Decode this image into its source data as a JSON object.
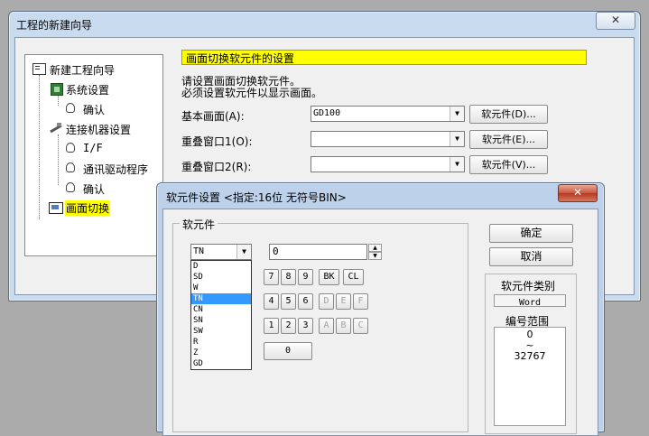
{
  "wizard": {
    "title": "工程的新建向导",
    "close_label": "✕",
    "tree": [
      {
        "label": "新建工程向导"
      },
      {
        "label": "系统设置"
      },
      {
        "label": "确认"
      },
      {
        "label": "连接机器设置"
      },
      {
        "label": "I/F"
      },
      {
        "label": "通讯驱动程序"
      },
      {
        "label": "确认"
      },
      {
        "label": "画面切换"
      }
    ],
    "header": "画面切换软元件的设置",
    "desc_line1": "请设置画面切换软元件。",
    "desc_line2": "必须设置软元件以显示画面。",
    "rows": [
      {
        "label": "基本画面(A):",
        "value": "GD100",
        "button": "软元件(D)..."
      },
      {
        "label": "重叠窗口1(O):",
        "value": "",
        "button": "软元件(E)..."
      },
      {
        "label": "重叠窗口2(R):",
        "value": "",
        "button": "软元件(V)..."
      }
    ],
    "accent": "#ffff00"
  },
  "dialog": {
    "title": "软元件设置 <指定:16位 无符号BIN>",
    "close_label": "✕",
    "group_label": "软元件",
    "device_type": "TN",
    "device_options": [
      "D",
      "SD",
      "W",
      "TN",
      "CN",
      "SN",
      "SW",
      "R",
      "Z",
      "GD"
    ],
    "selected_index": 3,
    "value": "0",
    "keypad": [
      [
        "7",
        "8",
        "9",
        "BK",
        "CL"
      ],
      [
        "4",
        "5",
        "6",
        "D",
        "E",
        "F"
      ],
      [
        "1",
        "2",
        "3",
        "A",
        "B",
        "C"
      ],
      [
        "0"
      ]
    ],
    "ok_label": "确定",
    "cancel_label": "取消",
    "category_label": "软元件类别",
    "category_value": "Word",
    "range_label": "编号范围",
    "range_min": "0",
    "range_sep": "~",
    "range_max": "32767",
    "selection_color": "#3399ff"
  }
}
